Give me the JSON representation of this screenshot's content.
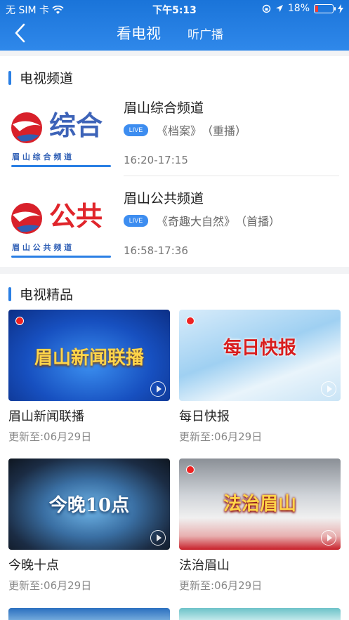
{
  "status_bar": {
    "carrier": "无 SIM 卡",
    "time": "下午5:13",
    "battery": "18%",
    "battery_level": 0.18
  },
  "nav": {
    "back_icon": "chevron-left-icon",
    "tabs": [
      {
        "label": "看电视",
        "active": true
      },
      {
        "label": "听广播",
        "active": false
      }
    ]
  },
  "tv_channels": {
    "title": "电视频道",
    "items": [
      {
        "logo_main": "综合",
        "logo_sub": "眉 山 综 合 频 道",
        "logo_color": "#3d63b8",
        "name": "眉山综合频道",
        "live": "LIVE",
        "program": "《档案》",
        "program_tag": "（重播）",
        "time": "16:20-17:15"
      },
      {
        "logo_main": "公共",
        "logo_sub": "眉 山 公 共 频 道",
        "logo_color": "#e0252b",
        "name": "眉山公共频道",
        "live": "LIVE",
        "program": "《奇趣大自然》",
        "program_tag": "（首播）",
        "time": "16:58-17:36"
      }
    ]
  },
  "featured": {
    "title": "电视精品",
    "items": [
      {
        "name": "眉山新闻联播",
        "thumb_text": "眉山新闻联播",
        "updated": "更新至:06月29日"
      },
      {
        "name": "每日快报",
        "thumb_text": "每日快报",
        "updated": "更新至:06月29日"
      },
      {
        "name": "今晚十点",
        "thumb_text": "今晚10点",
        "updated": "更新至:06月29日"
      },
      {
        "name": "法治眉山",
        "thumb_text": "法治眉山",
        "updated": "更新至:06月29日"
      }
    ]
  },
  "colors": {
    "header": "#1a74d9",
    "accent": "#2a7fe4",
    "live_badge": "#3d8df0"
  }
}
